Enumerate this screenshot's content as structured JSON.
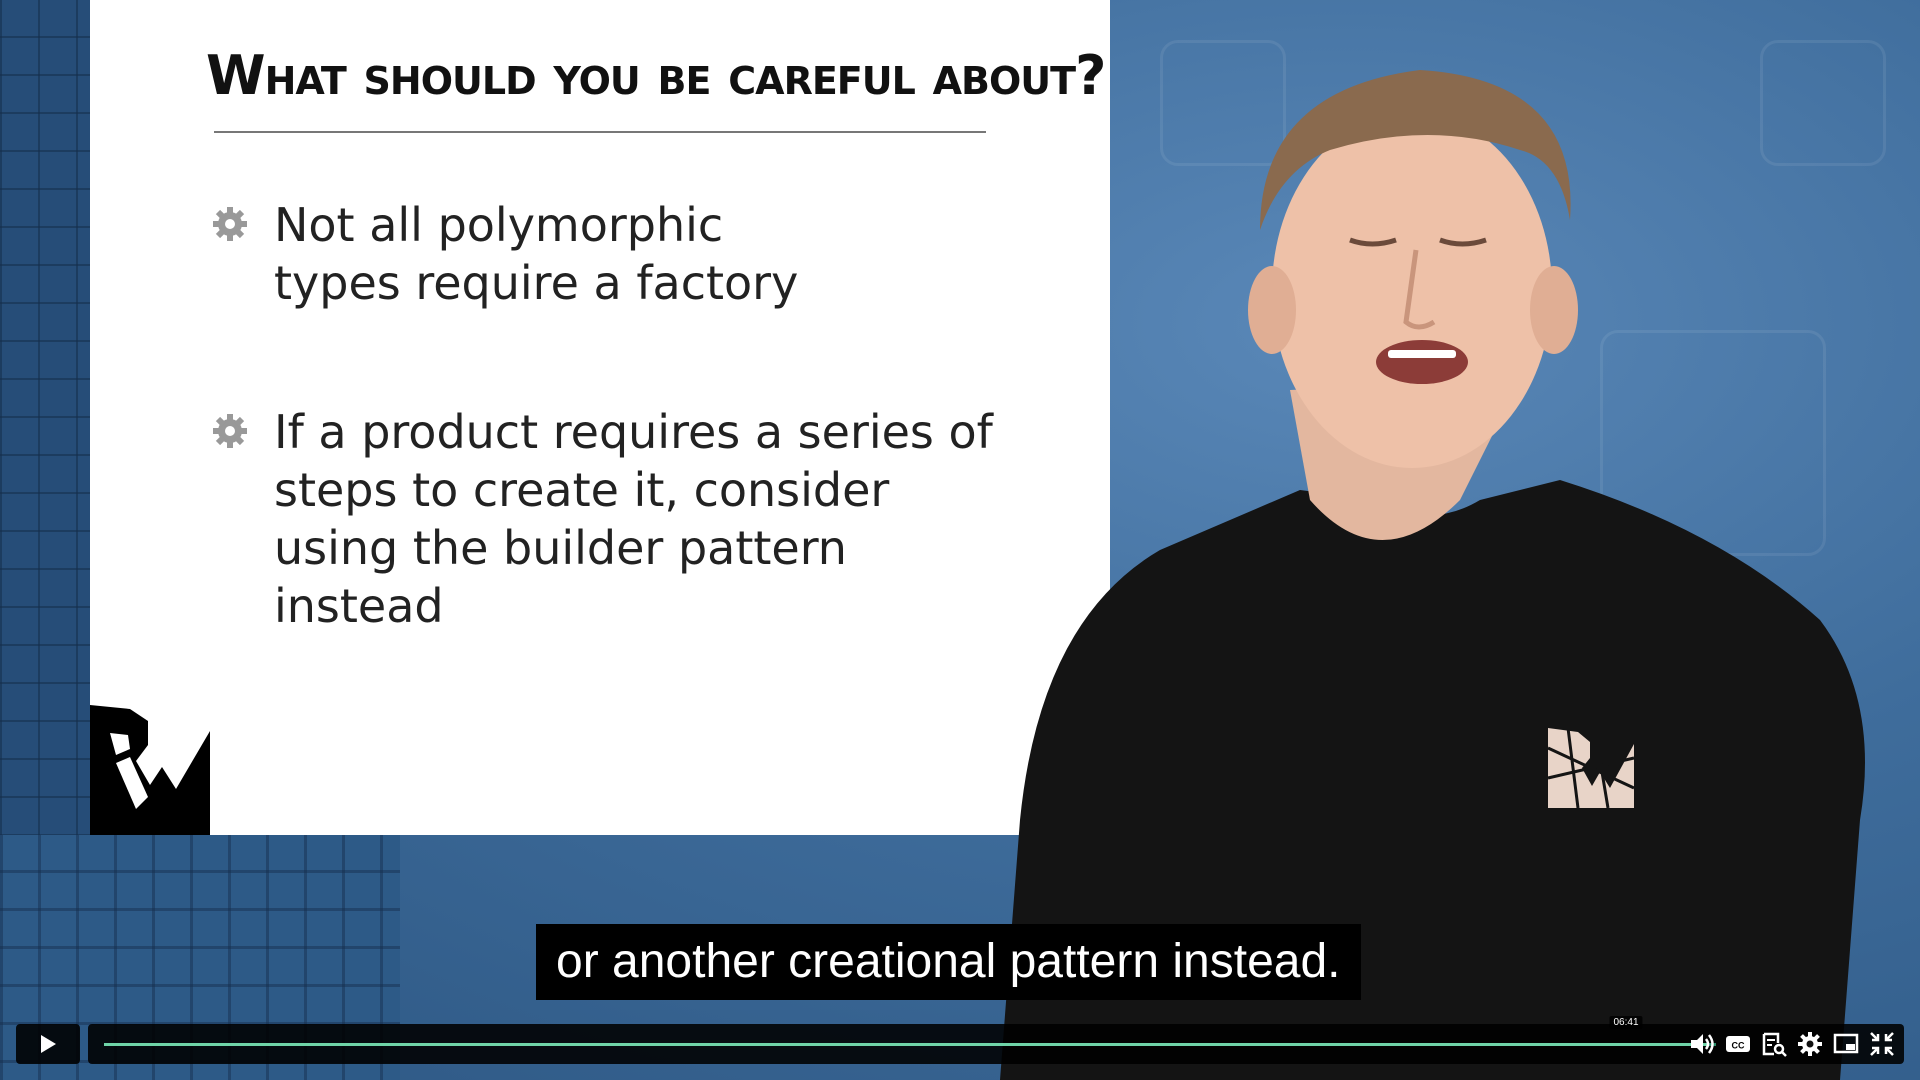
{
  "slide": {
    "title": "What should you be careful about?",
    "bullets": [
      "Not all polymorphic types require a factory",
      "If a product requires a series of steps to create it, consider using the builder pattern instead"
    ]
  },
  "caption": {
    "text": "or another creational pattern instead."
  },
  "player": {
    "hover_time": "06:41",
    "progress_fraction": 0.995,
    "accent_color": "#6fd4a8",
    "icons": [
      "play-icon",
      "volume-icon",
      "cc-icon",
      "transcript-icon",
      "settings-icon",
      "pip-icon",
      "exit-fullscreen-icon"
    ]
  }
}
